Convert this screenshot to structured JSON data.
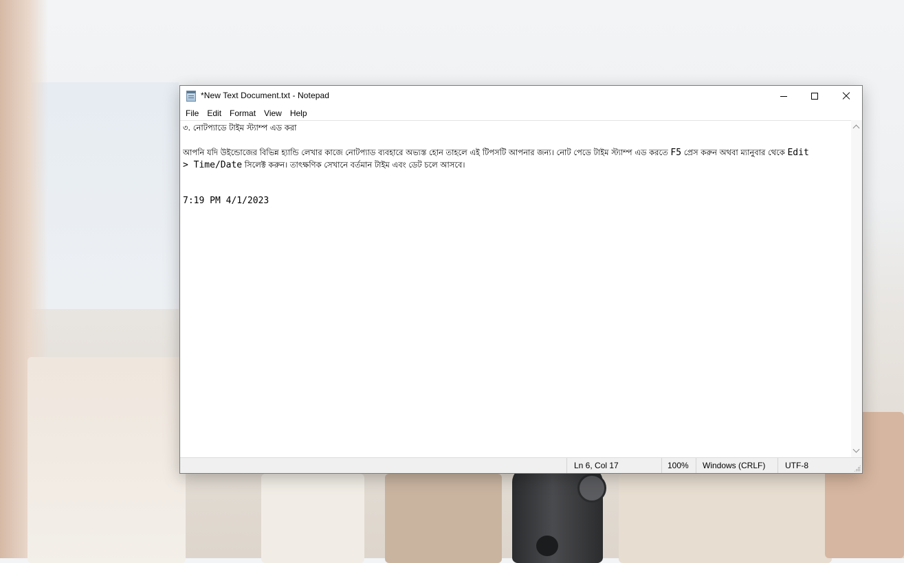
{
  "window": {
    "title": "*New Text Document.txt - Notepad"
  },
  "menu": {
    "items": [
      "File",
      "Edit",
      "Format",
      "View",
      "Help"
    ]
  },
  "editor": {
    "line1": "৩. নোটপ্যাডে টাইম স্ট্যাম্প এড করা",
    "line3_a": "আপনি যদি উইন্ডোজের বিভিন্ন হ্যান্ডি লেখার কাজে নোটপ্যাড ব্যবহারে অভ্যস্ত হোন তাহলে এই টিপসটি আপনার জন্য। নোট পেডে টাইম স্ট্যাম্প এড করতে ",
    "line3_key": "F5",
    "line3_b": " প্রেস করুন অথবা ম্যানুবার থেকে ",
    "line3_menu": "Edit",
    "line4_menu": "> Time/Date",
    "line4_b": " সিলেক্ট করুন। তাৎক্ষণিক সেখানে বর্তমান টাইম এবং ডেট চলে আসবে।",
    "line6": "7:19 PM 4/1/2023"
  },
  "status": {
    "position": "Ln 6, Col 17",
    "zoom": "100%",
    "line_ending": "Windows (CRLF)",
    "encoding": "UTF-8"
  }
}
